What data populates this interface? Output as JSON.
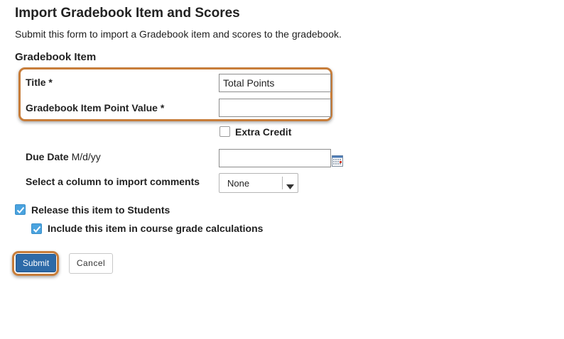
{
  "header": {
    "title": "Import Gradebook Item and Scores",
    "description": "Submit this form to import a Gradebook item and scores to the gradebook."
  },
  "section": {
    "heading": "Gradebook Item"
  },
  "form": {
    "title_label": "Title *",
    "title_value": "Total Points",
    "point_value_label": "Gradebook Item Point Value *",
    "point_value_value": "",
    "extra_credit_label": "Extra Credit",
    "extra_credit_checked": false,
    "due_date_label": "Due Date",
    "due_date_format": "M/d/yy",
    "due_date_value": "",
    "comments_label": "Select a column to import comments",
    "comments_selected": "None",
    "release_label": "Release this item to Students",
    "release_checked": true,
    "include_label": "Include this item in course grade calculations",
    "include_checked": true
  },
  "actions": {
    "submit_label": "Submit",
    "cancel_label": "Cancel"
  },
  "colors": {
    "highlight": "#c77d3a",
    "submit_bg": "#2d6aa8",
    "checkbox_checked": "#4aa3df"
  },
  "icons": {
    "calendar": "calendar-icon",
    "dropdown": "chevron-down-icon",
    "check": "checkmark-icon"
  }
}
